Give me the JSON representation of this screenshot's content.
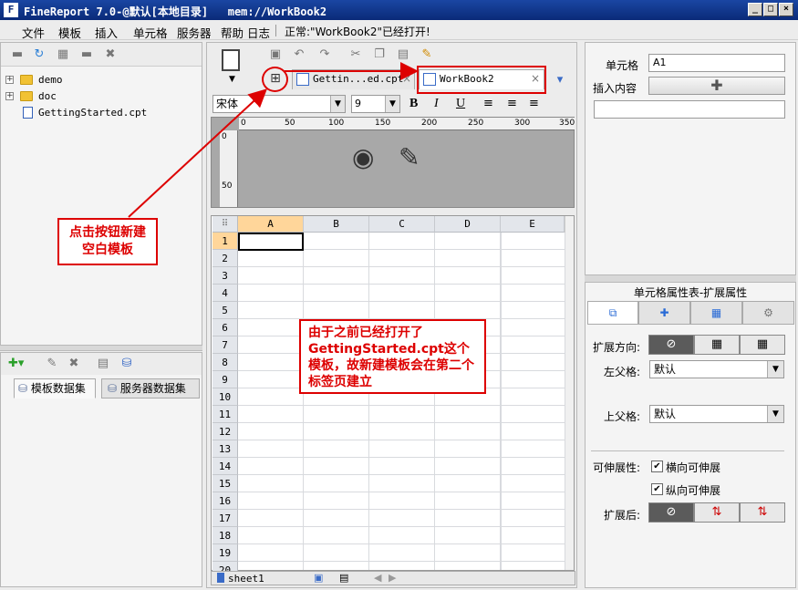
{
  "window": {
    "title": "FineReport 7.0-@默认[本地目录]   mem://WorkBook2",
    "logo": "F"
  },
  "menus": [
    "文件",
    "模板",
    "插入",
    "单元格",
    "服务器",
    "帮助",
    "日志",
    "正常:\"WorkBook2\"已经打开!"
  ],
  "tree": {
    "items": [
      "demo",
      "doc",
      "GettingStarted.cpt"
    ]
  },
  "datasets": {
    "tabs": [
      "模板数据集",
      "服务器数据集"
    ]
  },
  "editor": {
    "tabs": [
      "Gettin...ed.cpt",
      "WorkBook2"
    ],
    "font_name": "宋体",
    "font_size": "9",
    "ruler_h": [
      "0",
      "50",
      "100",
      "150",
      "200",
      "250",
      "300",
      "350"
    ],
    "ruler_v": [
      "0",
      "50"
    ],
    "columns": [
      "A",
      "B",
      "C",
      "D",
      "E"
    ],
    "rows": [
      "1",
      "2",
      "3",
      "4",
      "5",
      "6",
      "7",
      "8",
      "9",
      "10",
      "11",
      "12",
      "13",
      "14",
      "15",
      "16",
      "17",
      "18",
      "19",
      "20"
    ],
    "sheet_tab": "sheet1"
  },
  "right": {
    "cell_label": "单元格",
    "cell_value": "A1",
    "insert_label": "插入内容",
    "props_title": "单元格属性表-扩展属性",
    "expand_dir_label": "扩展方向:",
    "left_parent_label": "左父格:",
    "left_parent_value": "默认",
    "up_parent_label": "上父格:",
    "up_parent_value": "默认",
    "stretch_label": "可伸展性:",
    "stretch_h": "横向可伸展",
    "stretch_v": "纵向可伸展",
    "after_expand_label": "扩展后:"
  },
  "callouts": {
    "left": "点击按钮新建空白模板",
    "center": "由于之前已经打开了GettingStarted.cpt这个模板，故新建模板会在第二个标签页建立"
  },
  "colors": {
    "accent": "#d00000",
    "title": "#0a2a78"
  }
}
